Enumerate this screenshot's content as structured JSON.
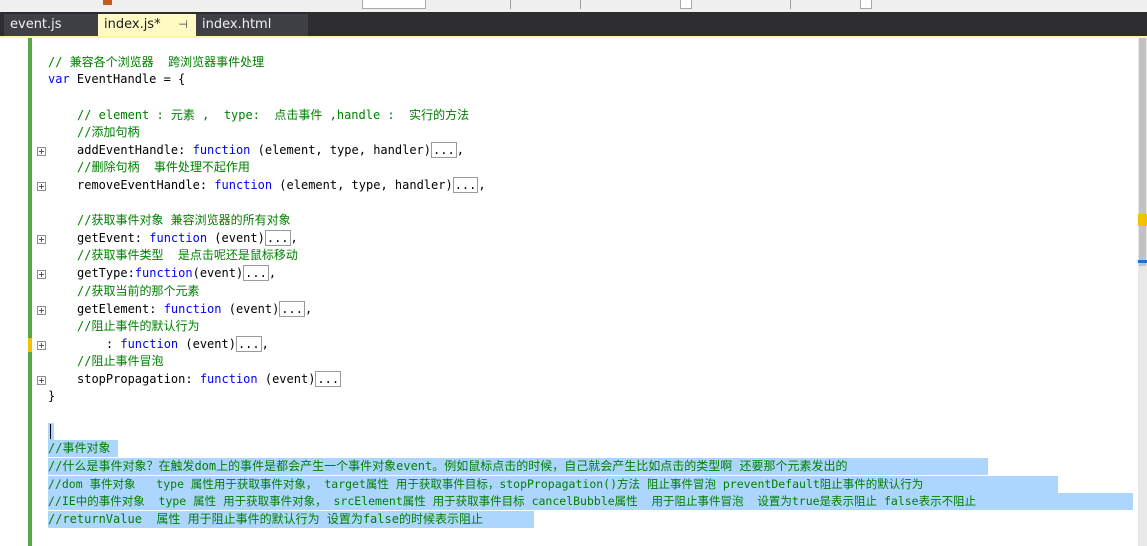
{
  "tabs": [
    {
      "label": "event.js"
    },
    {
      "label": "index.js*"
    },
    {
      "label": "index.html"
    }
  ],
  "code": {
    "l1": "// 兼容各个浏览器  跨浏览器事件处理",
    "l2_kw": "var",
    "l2_rest": " EventHandle = {",
    "l3": "// element : 元素 ,  type:  点击事件 ,handle :  实行的方法",
    "l4": "//添加句柄",
    "l5_a": "addEventHandle: ",
    "l5_kw": "function",
    "l5_b": " (element, type, handler)",
    "l6": "//删除句柄  事件处理不起作用",
    "l7_a": "removeEventHandle: ",
    "l7_kw": "function",
    "l7_b": " (element, type, handler)",
    "l8": "//获取事件对象 兼容浏览器的所有对象",
    "l9_a": "getEvent: ",
    "l9_kw": "function",
    "l9_b": " (event)",
    "l10": "//获取事件类型  是点击呢还是鼠标移动",
    "l11_a": "getType:",
    "l11_kw": "function",
    "l11_b": "(event)",
    "l12": "//获取当前的那个元素",
    "l13_a": "getElement: ",
    "l13_kw": "function",
    "l13_b": " (event)",
    "l14": "//阻止事件的默认行为",
    "l15_a": "    : ",
    "l15_kw": "function",
    "l15_b": " (event)",
    "l16": "//阻止事件冒泡",
    "l17_a": "stopPropagation: ",
    "l17_kw": "function",
    "l17_b": " (event)",
    "l18": "}",
    "ellipsis": "...",
    "sep": ",",
    "s1": "//事件对象",
    "s2": "//什么是事件对象？在触发dom上的事件是都会产生一个事件对象event。例如鼠标点击的时候，自己就会产生比如点击的类型啊 还要那个元素发出的",
    "s3": "//dom 事件对象   type 属性用于获取事件对象， target属性 用于获取事件目标，stopPropagation()方法 阻止事件冒泡 preventDefault阻止事件的默认行为",
    "s4": "//IE中的事件对象  type 属性 用于获取事件对象， srcElement属性 用于获取事件目标 cancelBubble属性  用于阻止事件冒泡  设置为true是表示阻止 false表示不阻止",
    "s5": "//returnValue  属性 用于阻止事件的默认行为 设置为false的时候表示阻止"
  },
  "colors": {
    "comment": "#008000",
    "keyword": "#0000ff",
    "selection": "#add6ff",
    "active_tab": "#fff9c4",
    "change_bar": "#57a64a"
  },
  "icons": [
    "pin-icon",
    "expand-icon"
  ]
}
